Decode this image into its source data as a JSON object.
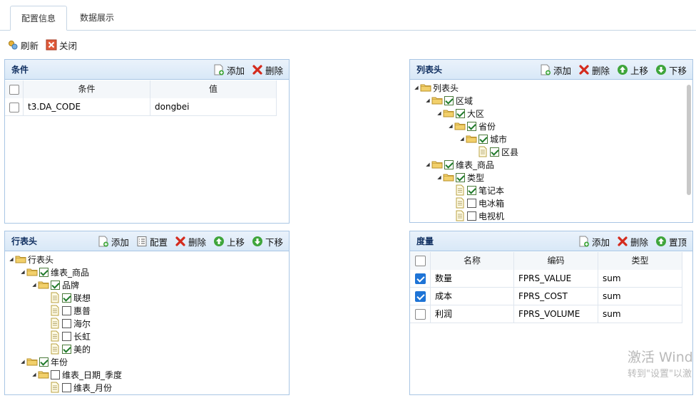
{
  "tabs": [
    {
      "label": "配置信息",
      "active": true
    },
    {
      "label": "数据展示",
      "active": false
    }
  ],
  "toolbar": {
    "refresh": "刷新",
    "close": "关闭"
  },
  "conditions": {
    "title": "条件",
    "buttons": {
      "add": "添加",
      "delete": "删除"
    },
    "columns": [
      "条件",
      "值"
    ],
    "rows": [
      {
        "checked": false,
        "condition": "t3.DA_CODE",
        "value": "dongbei"
      }
    ]
  },
  "column_header": {
    "title": "列表头",
    "buttons": {
      "add": "添加",
      "delete": "删除",
      "up": "上移",
      "down": "下移"
    },
    "tree": [
      {
        "label": "列表头",
        "depth": 0,
        "type": "folder",
        "checkbox": false,
        "expanded": true
      },
      {
        "label": "区域",
        "depth": 1,
        "type": "folder",
        "checkbox": true,
        "checked": true,
        "expanded": true
      },
      {
        "label": "大区",
        "depth": 2,
        "type": "folder",
        "checkbox": true,
        "checked": true,
        "expanded": true
      },
      {
        "label": "省份",
        "depth": 3,
        "type": "folder",
        "checkbox": true,
        "checked": true,
        "expanded": true
      },
      {
        "label": "城市",
        "depth": 4,
        "type": "folder",
        "checkbox": true,
        "checked": true,
        "expanded": true
      },
      {
        "label": "区县",
        "depth": 5,
        "type": "file",
        "checkbox": true,
        "checked": true
      },
      {
        "label": "维表_商品",
        "depth": 1,
        "type": "folder",
        "checkbox": true,
        "checked": true,
        "expanded": true
      },
      {
        "label": "类型",
        "depth": 2,
        "type": "folder",
        "checkbox": true,
        "checked": true,
        "expanded": true
      },
      {
        "label": "笔记本",
        "depth": 3,
        "type": "file",
        "checkbox": true,
        "checked": true
      },
      {
        "label": "电冰箱",
        "depth": 3,
        "type": "file",
        "checkbox": true,
        "checked": false
      },
      {
        "label": "电视机",
        "depth": 3,
        "type": "file",
        "checkbox": true,
        "checked": false
      }
    ]
  },
  "row_header": {
    "title": "行表头",
    "buttons": {
      "add": "添加",
      "config": "配置",
      "delete": "删除",
      "up": "上移",
      "down": "下移"
    },
    "tree": [
      {
        "label": "行表头",
        "depth": 0,
        "type": "folder",
        "checkbox": false,
        "expanded": true
      },
      {
        "label": "维表_商品",
        "depth": 1,
        "type": "folder",
        "checkbox": true,
        "checked": true,
        "expanded": true
      },
      {
        "label": "品牌",
        "depth": 2,
        "type": "folder",
        "checkbox": true,
        "checked": true,
        "expanded": true
      },
      {
        "label": "联想",
        "depth": 3,
        "type": "file",
        "checkbox": true,
        "checked": true
      },
      {
        "label": "惠普",
        "depth": 3,
        "type": "file",
        "checkbox": true,
        "checked": false
      },
      {
        "label": "海尔",
        "depth": 3,
        "type": "file",
        "checkbox": true,
        "checked": false
      },
      {
        "label": "长虹",
        "depth": 3,
        "type": "file",
        "checkbox": true,
        "checked": false
      },
      {
        "label": "美的",
        "depth": 3,
        "type": "file",
        "checkbox": true,
        "checked": true
      },
      {
        "label": "年份",
        "depth": 1,
        "type": "folder",
        "checkbox": true,
        "checked": true,
        "expanded": true
      },
      {
        "label": "维表_日期_季度",
        "depth": 2,
        "type": "folder",
        "checkbox": true,
        "checked": false,
        "expanded": true
      },
      {
        "label": "维表_月份",
        "depth": 3,
        "type": "file",
        "checkbox": true,
        "checked": false
      }
    ]
  },
  "measures": {
    "title": "度量",
    "buttons": {
      "add": "添加",
      "delete": "删除",
      "top": "置顶"
    },
    "columns": [
      "名称",
      "编码",
      "类型"
    ],
    "rows": [
      {
        "checked": true,
        "name": "数量",
        "code": "FPRS_VALUE",
        "type": "sum"
      },
      {
        "checked": true,
        "name": "成本",
        "code": "FPRS_COST",
        "type": "sum"
      },
      {
        "checked": false,
        "name": "利润",
        "code": "FPRS_VOLUME",
        "type": "sum"
      }
    ]
  },
  "watermark": {
    "line1": "激活 Wind",
    "line2": "转到\"设置\"以激"
  },
  "colors": {
    "panel_border": "#a9c6e4",
    "header_title": "#0e2d5f",
    "check_blue": "#1e74d6"
  }
}
